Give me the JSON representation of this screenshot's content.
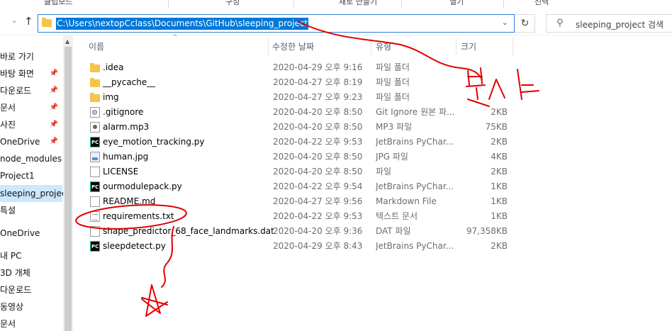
{
  "ribbon": {
    "items": [
      "클립보드",
      "구성",
      "새로 만들기",
      "열기",
      "선택"
    ]
  },
  "address": {
    "path": "C:\\Users\\nextopCclass\\Documents\\GitHub\\sleeping_project",
    "search_placeholder": "sleeping_project 검색"
  },
  "sidebar": {
    "items": [
      {
        "label": "바로 가기",
        "pinned": false
      },
      {
        "label": "바탕 화면",
        "pinned": true
      },
      {
        "label": "다운로드",
        "pinned": true
      },
      {
        "label": "문서",
        "pinned": true
      },
      {
        "label": "사진",
        "pinned": true
      },
      {
        "label": "OneDrive",
        "pinned": true
      },
      {
        "label": "node_modules",
        "pinned": false
      },
      {
        "label": "Project1",
        "pinned": false
      },
      {
        "label": "sleeping_project",
        "pinned": false,
        "selected": true
      },
      {
        "label": "특설",
        "pinned": false
      },
      {
        "label": "OneDrive",
        "pinned": false
      },
      {
        "label": "내 PC",
        "pinned": false
      },
      {
        "label": "3D 개체",
        "pinned": false
      },
      {
        "label": "다운로드",
        "pinned": false
      },
      {
        "label": "동영상",
        "pinned": false
      },
      {
        "label": "문서",
        "pinned": false
      }
    ]
  },
  "columns": {
    "name": "이름",
    "modified": "수정한 날짜",
    "type": "유형",
    "size": "크기"
  },
  "files": [
    {
      "name": ".idea",
      "modified": "2020-04-29 오후 9:16",
      "type": "파일 폴더",
      "size": "",
      "icon": "folder-icon"
    },
    {
      "name": "__pycache__",
      "modified": "2020-04-27 오후 8:19",
      "type": "파일 폴더",
      "size": "",
      "icon": "folder-icon"
    },
    {
      "name": "img",
      "modified": "2020-04-27 오후 9:23",
      "type": "파일 폴더",
      "size": "",
      "icon": "folder-icon"
    },
    {
      "name": ".gitignore",
      "modified": "2020-04-20 오후 8:50",
      "type": "Git Ignore 원본 파...",
      "size": "2KB",
      "icon": "gear-file-icon"
    },
    {
      "name": "alarm.mp3",
      "modified": "2020-04-20 오후 8:50",
      "type": "MP3 파일",
      "size": "75KB",
      "icon": "audio-file-icon"
    },
    {
      "name": "eye_motion_tracking.py",
      "modified": "2020-04-22 오후 9:53",
      "type": "JetBrains PyChar...",
      "size": "2KB",
      "icon": "pycharm-icon"
    },
    {
      "name": "human.jpg",
      "modified": "2020-04-20 오후 8:50",
      "type": "JPG 파일",
      "size": "4KB",
      "icon": "image-file-icon"
    },
    {
      "name": "LICENSE",
      "modified": "2020-04-20 오후 8:50",
      "type": "파일",
      "size": "2KB",
      "icon": "blank-file-icon"
    },
    {
      "name": "ourmodulepack.py",
      "modified": "2020-04-22 오후 9:54",
      "type": "JetBrains PyChar...",
      "size": "1KB",
      "icon": "pycharm-icon"
    },
    {
      "name": "README.md",
      "modified": "2020-04-27 오후 9:56",
      "type": "Markdown File",
      "size": "1KB",
      "icon": "blank-file-icon"
    },
    {
      "name": "requirements.txt",
      "modified": "2020-04-22 오후 9:53",
      "type": "텍스트 문서",
      "size": "1KB",
      "icon": "text-file-icon"
    },
    {
      "name": "shape_predictor_68_face_landmarks.dat",
      "modified": "2020-04-20 오후 9:36",
      "type": "DAT 파일",
      "size": "97,358KB",
      "icon": "blank-file-icon"
    },
    {
      "name": "sleepdetect.py",
      "modified": "2020-04-29 오후 8:43",
      "type": "JetBrains PyChar...",
      "size": "2KB",
      "icon": "pycharm-icon"
    }
  ],
  "annotation": {
    "color": "#e00000",
    "text": "복사"
  }
}
